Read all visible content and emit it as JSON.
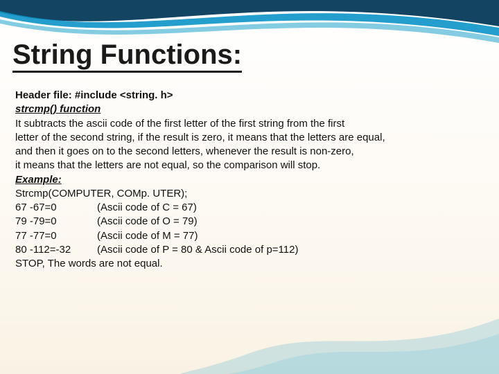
{
  "title": "String Functions:",
  "body": {
    "header_file": "Header file: #include <string. h>",
    "function_heading": "strcmp() function",
    "desc": [
      "It subtracts the ascii code of the first letter of the first string from the first",
      "letter of the second string, if the result is zero, it means that the letters are equal,",
      " and then it goes on to the second letters, whenever the result is non-zero,",
      "it means that the letters are not equal, so the comparison will stop."
    ],
    "example_heading": "Example:",
    "example_call": "Strcmp(COMPUTER, COMp. UTER);",
    "rows": [
      {
        "calc": "67 -67=0",
        "note": "(Ascii code of C = 67)"
      },
      {
        "calc": "79 -79=0",
        "note": "(Ascii code of O = 79)"
      },
      {
        "calc": "77 -77=0",
        "note": "(Ascii code of M = 77)"
      },
      {
        "calc": "80 -112=-32",
        "note": "(Ascii code of P = 80 & Ascii code of p=112)"
      }
    ],
    "stop": "STOP, The words are not equal."
  }
}
